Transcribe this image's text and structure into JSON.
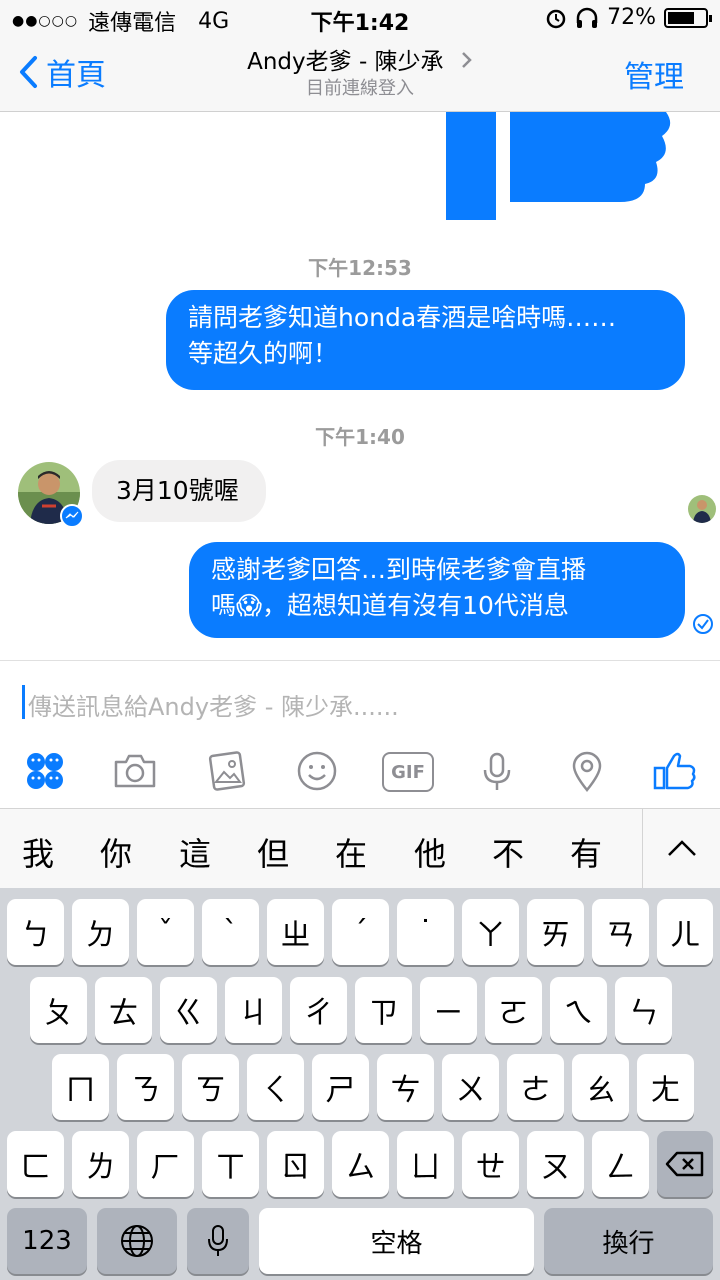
{
  "status_bar": {
    "carrier": "遠傳電信",
    "network": "4G",
    "time": "下午1:42",
    "battery": "72%",
    "battery_level": 0.72
  },
  "nav": {
    "back_label": "首頁",
    "title": "Andy老爹 - 陳少承",
    "subtitle": "目前連線登入",
    "manage_label": "管理"
  },
  "messages": [
    {
      "type": "time",
      "text": "下午12:53"
    },
    {
      "type": "out",
      "lines": [
        "請問老爹知道honda春酒是啥時嗎……",
        "等超久的啊！"
      ]
    },
    {
      "type": "time",
      "text": "下午1:40"
    },
    {
      "type": "in",
      "text": "3月10號喔"
    },
    {
      "type": "out",
      "lines": [
        "感謝老爹回答…到時候老爹會直播",
        "嗎😱，超想知道有沒有10代消息"
      ]
    }
  ],
  "composer": {
    "placeholder": "傳送訊息給Andy老爹 - 陳少承......"
  },
  "toolbar_icons": [
    "emoji-sticker-icon",
    "camera-icon",
    "gallery-icon",
    "smiley-icon",
    "gif-icon",
    "microphone-icon",
    "location-icon",
    "thumbs-up-icon"
  ],
  "toolbar_gif_label": "GIF",
  "candidates": [
    "我",
    "你",
    "這",
    "但",
    "在",
    "他",
    "不",
    "有"
  ],
  "keyboard": {
    "row1": [
      "ㄅ",
      "ㄉ",
      "ˇ",
      "ˋ",
      "ㄓ",
      "ˊ",
      "˙",
      "ㄚ",
      "ㄞ",
      "ㄢ",
      "ㄦ"
    ],
    "row2": [
      "ㄆ",
      "ㄊ",
      "ㄍ",
      "ㄐ",
      "ㄔ",
      "ㄗ",
      "ㄧ",
      "ㄛ",
      "ㄟ",
      "ㄣ"
    ],
    "row3": [
      "ㄇ",
      "ㄋ",
      "ㄎ",
      "ㄑ",
      "ㄕ",
      "ㄘ",
      "ㄨ",
      "ㄜ",
      "ㄠ",
      "ㄤ"
    ],
    "row4": [
      "ㄈ",
      "ㄌ",
      "ㄏ",
      "ㄒ",
      "ㄖ",
      "ㄙ",
      "ㄩ",
      "ㄝ",
      "ㄡ",
      "ㄥ"
    ],
    "numbers_label": "123",
    "space_label": "空格",
    "return_label": "換行"
  },
  "colors": {
    "accent": "#0a7cff",
    "incoming_bubble": "#f1f0f0",
    "keyboard_bg": "#d1d4d9"
  }
}
